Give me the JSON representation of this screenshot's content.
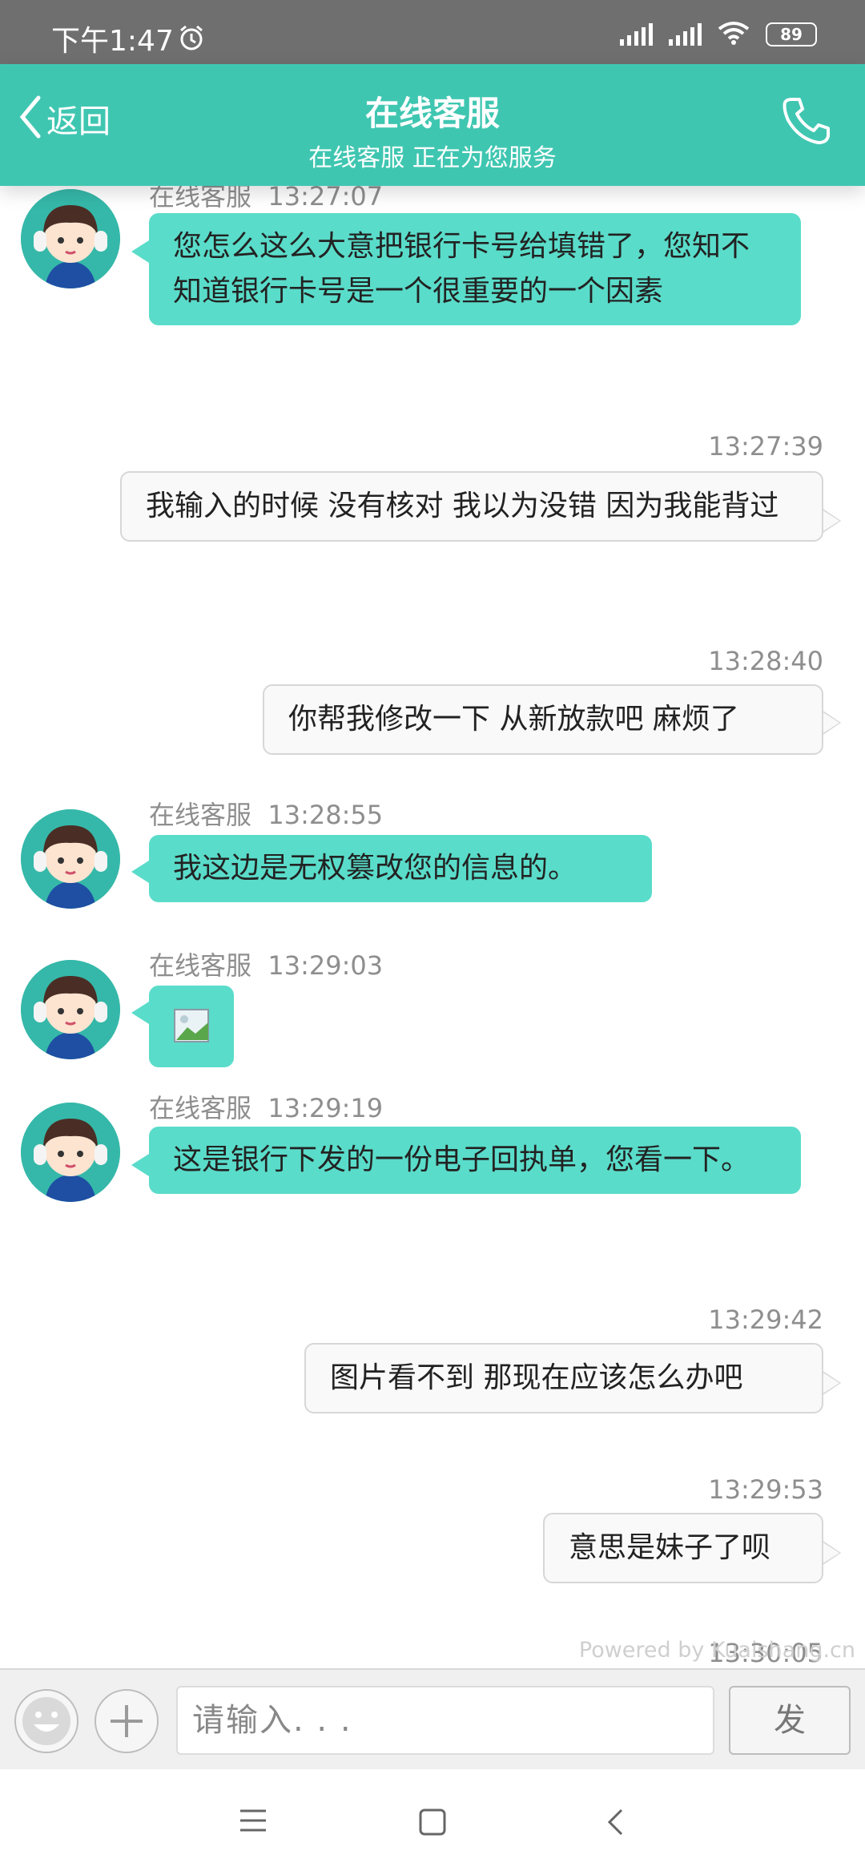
{
  "status_bar": {
    "time": "下午1:47",
    "battery": "89"
  },
  "header": {
    "back_label": "返回",
    "title": "在线客服",
    "subtitle": "在线客服 正在为您服务"
  },
  "messages": [
    {
      "from": "agent",
      "sender": "在线客服",
      "time": "13:27:07",
      "text": "您怎么这么大意把银行卡号给填错了，您知不知道银行卡号是一个很重要的一个因素"
    },
    {
      "from": "user",
      "time": "13:27:39",
      "text": "我输入的时候 没有核对 我以为没错 因为我能背过"
    },
    {
      "from": "user",
      "time": "13:28:40",
      "text": "你帮我修改一下 从新放款吧 麻烦了"
    },
    {
      "from": "agent",
      "sender": "在线客服",
      "time": "13:28:55",
      "text": "我这边是无权篡改您的信息的。"
    },
    {
      "from": "agent",
      "sender": "在线客服",
      "time": "13:29:03",
      "text": "",
      "image": "broken-image-icon"
    },
    {
      "from": "agent",
      "sender": "在线客服",
      "time": "13:29:19",
      "text": "这是银行下发的一份电子回执单，您看一下。"
    },
    {
      "from": "user",
      "time": "13:29:42",
      "text": "图片看不到 那现在应该怎么办吧"
    },
    {
      "from": "user",
      "time": "13:29:53",
      "text": "意思是妹子了呗"
    },
    {
      "from": "user",
      "time": "13:30:05",
      "text": ""
    }
  ],
  "powered_by": "Powered by Kuaishang.cn",
  "input": {
    "placeholder": "请输入. . .",
    "value": "",
    "send_label": "发 送"
  },
  "icons": {
    "back": "chevron-left-icon",
    "phone": "phone-icon",
    "alarm": "alarm-clock-icon",
    "emoji": "smiley-icon",
    "plus": "plus-icon",
    "nav": [
      "menu-icon",
      "home-square-icon",
      "back-chevron-icon"
    ]
  },
  "colors": {
    "header": "#3fc6b1",
    "agent_bubble": "#5adcca",
    "user_bubble": "#f9f9f9",
    "status_bar": "#6f6f6f"
  }
}
